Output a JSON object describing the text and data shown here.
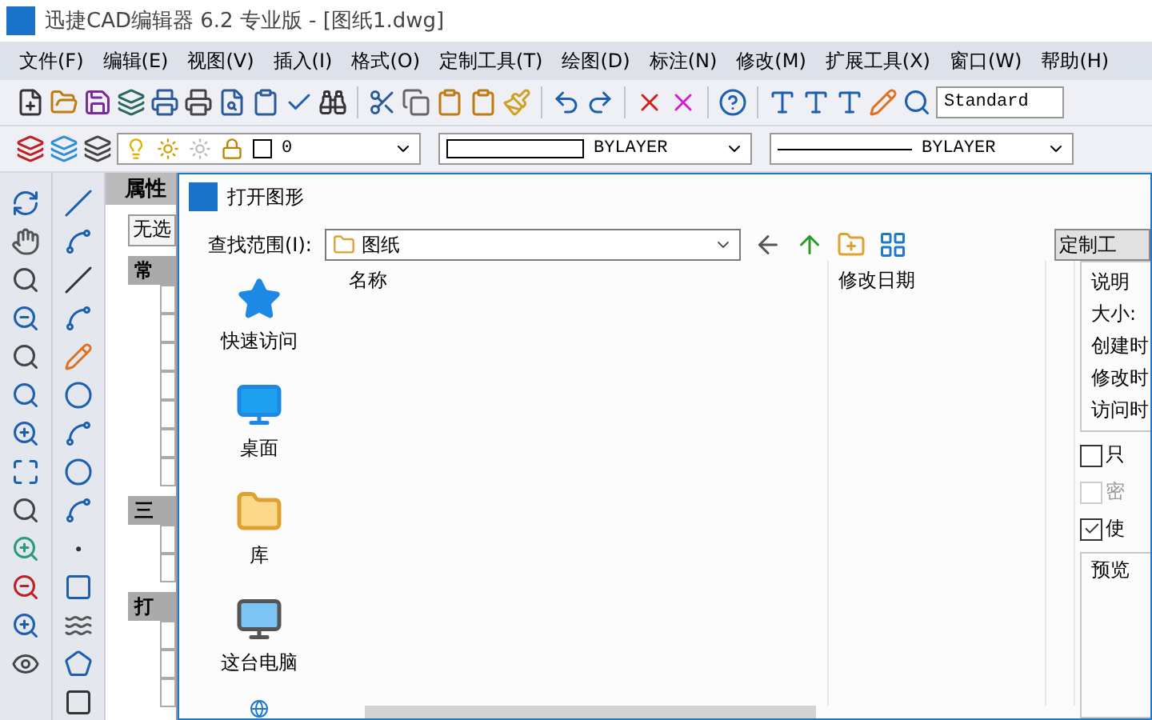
{
  "window": {
    "title": "迅捷CAD编辑器 6.2 专业版  - [图纸1.dwg]"
  },
  "menu": [
    "文件(F)",
    "编辑(E)",
    "视图(V)",
    "插入(I)",
    "格式(O)",
    "定制工具(T)",
    "绘图(D)",
    "标注(N)",
    "修改(M)",
    "扩展工具(X)",
    "窗口(W)",
    "帮助(H)"
  ],
  "style_combo": {
    "value": "Standard"
  },
  "layer_combo": {
    "value": "0"
  },
  "linetype_combo": {
    "value": "BYLAYER"
  },
  "lineweight_combo": {
    "value": "BYLAYER"
  },
  "properties_panel": {
    "title": "属性",
    "selection": "无选",
    "groups": [
      "常",
      "三",
      "打"
    ]
  },
  "dialog": {
    "title": "打开图形",
    "look_in_label": "查找范围(I):",
    "look_in_value": "图纸",
    "places": [
      {
        "label": "快速访问"
      },
      {
        "label": "桌面"
      },
      {
        "label": "库"
      },
      {
        "label": "这台电脑"
      }
    ],
    "columns": [
      "名称",
      "修改日期"
    ],
    "custom_tools_button": "定制工",
    "description": {
      "title": "说明",
      "fields": [
        "大小:",
        "创建时",
        "修改时",
        "访问时"
      ]
    },
    "options": [
      {
        "label": "只",
        "checked": false,
        "disabled": false
      },
      {
        "label": "密",
        "checked": false,
        "disabled": true
      },
      {
        "label": "使",
        "checked": true,
        "disabled": false
      }
    ],
    "preview": {
      "title": "预览"
    }
  }
}
